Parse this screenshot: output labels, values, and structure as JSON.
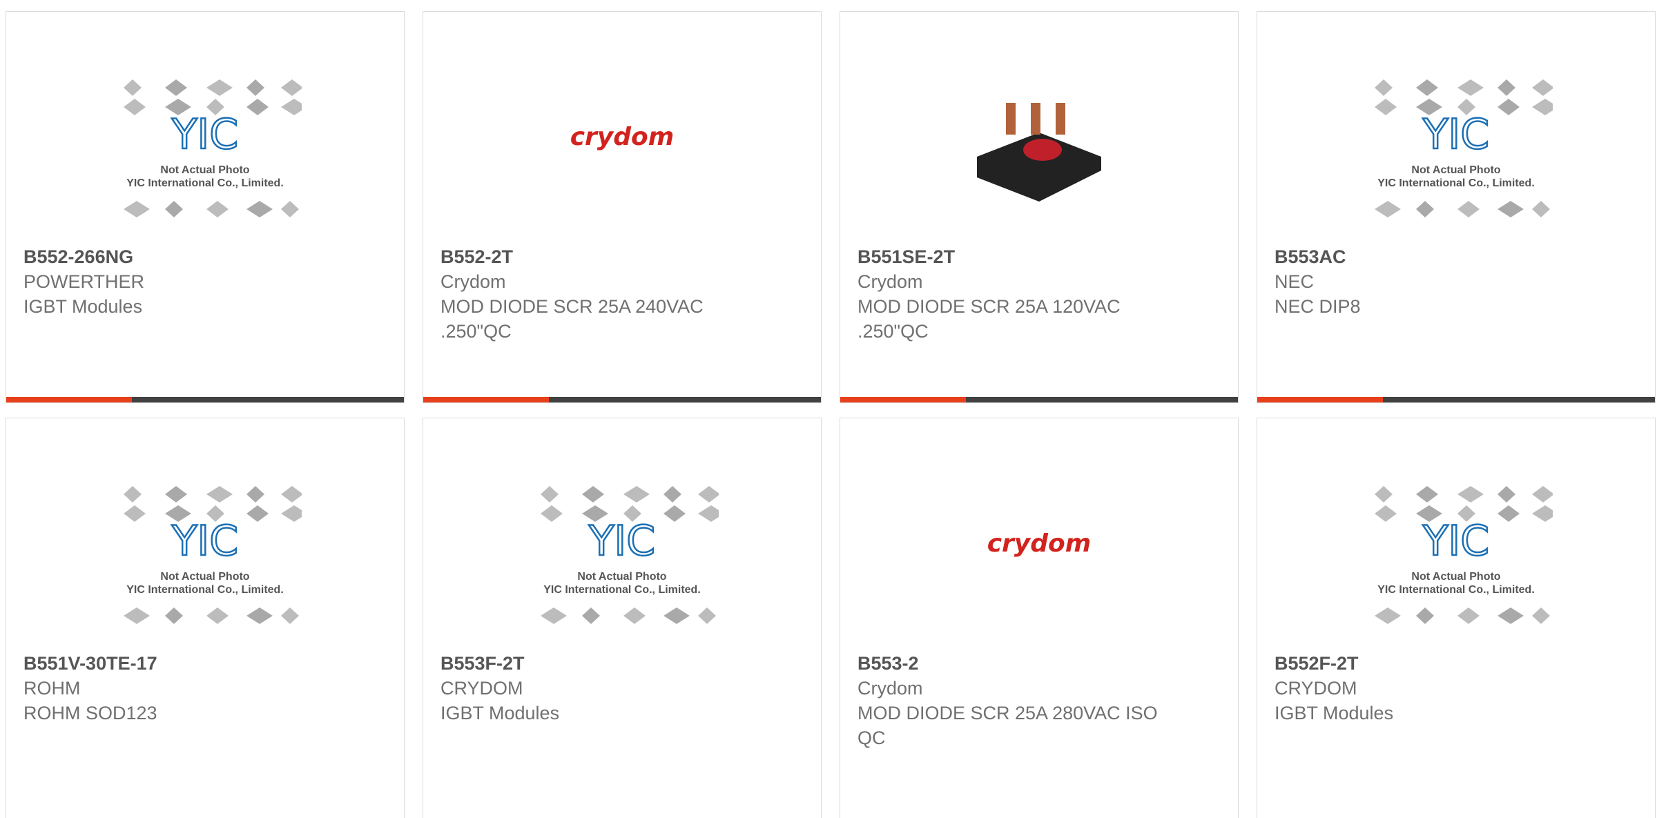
{
  "products": [
    {
      "part_number": "B552-266NG",
      "manufacturer": "POWERTHER",
      "description": "IGBT Modules",
      "image": "placeholder",
      "placeholder_line1": "Not Actual Photo",
      "placeholder_line2": "YIC International Co., Limited."
    },
    {
      "part_number": "B552-2T",
      "manufacturer": "Crydom",
      "description": "MOD DIODE SCR 25A 240VAC .250\"QC",
      "image": "crydom-logo",
      "logo_text": "crydom"
    },
    {
      "part_number": "B551SE-2T",
      "manufacturer": "Crydom",
      "description": "MOD DIODE SCR 25A 120VAC .250\"QC",
      "image": "module-photo"
    },
    {
      "part_number": "B553AC",
      "manufacturer": "NEC",
      "description": "NEC DIP8",
      "image": "placeholder",
      "placeholder_line1": "Not Actual Photo",
      "placeholder_line2": "YIC International Co., Limited."
    },
    {
      "part_number": "B551V-30TE-17",
      "manufacturer": "ROHM",
      "description": "ROHM SOD123",
      "image": "placeholder",
      "placeholder_line1": "Not Actual Photo",
      "placeholder_line2": "YIC International Co., Limited."
    },
    {
      "part_number": "B553F-2T",
      "manufacturer": "CRYDOM",
      "description": "IGBT Modules",
      "image": "placeholder",
      "placeholder_line1": "Not Actual Photo",
      "placeholder_line2": "YIC International Co., Limited."
    },
    {
      "part_number": "B553-2",
      "manufacturer": "Crydom",
      "description": "MOD DIODE SCR 25A 280VAC ISO QC",
      "image": "crydom-logo",
      "logo_text": "crydom"
    },
    {
      "part_number": "B552F-2T",
      "manufacturer": "CRYDOM",
      "description": "IGBT Modules",
      "image": "placeholder",
      "placeholder_line1": "Not Actual Photo",
      "placeholder_line2": "YIC International Co., Limited."
    }
  ],
  "colors": {
    "accent": "#e8401a",
    "bar": "#414141",
    "card_border": "#dadada",
    "logo_blue": "#1a6fb5",
    "crydom_red": "#d2231e"
  }
}
